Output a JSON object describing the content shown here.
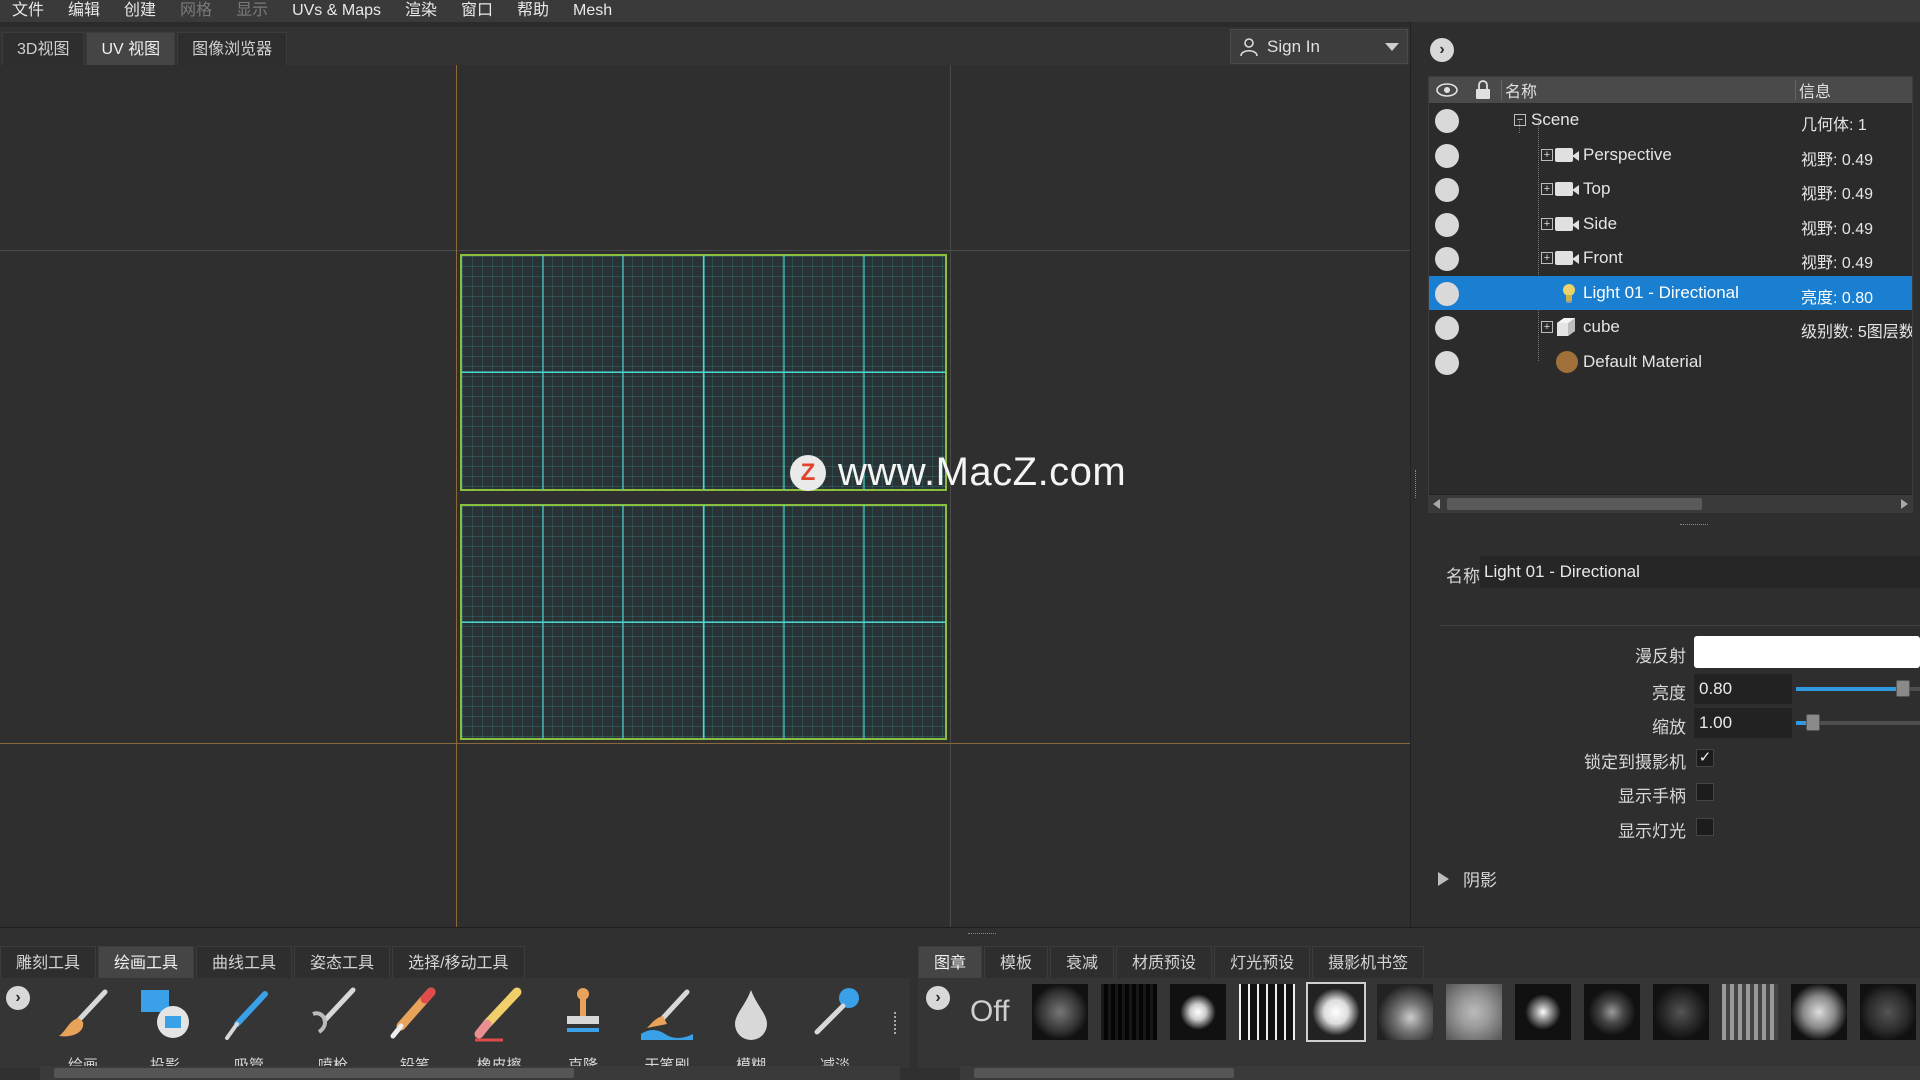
{
  "menu": {
    "file": "文件",
    "edit": "编辑",
    "create": "创建",
    "mesh_cn": "网格",
    "display": "显示",
    "uvs": "UVs & Maps",
    "render": "渲染",
    "window": "窗口",
    "help": "帮助",
    "mesh": "Mesh"
  },
  "view_tabs": [
    {
      "label": "3D视图"
    },
    {
      "label": "UV 视图"
    },
    {
      "label": "图像浏览器"
    }
  ],
  "signin": {
    "label": "Sign In"
  },
  "watermark": {
    "logo": "Z",
    "text": "www.MacZ.com"
  },
  "tree": {
    "header": {
      "name": "名称",
      "info": "信息"
    },
    "rows": [
      {
        "label": "Scene",
        "info": "几何体: 1"
      },
      {
        "label": "Perspective",
        "info": "视野: 0.49"
      },
      {
        "label": "Top",
        "info": "视野: 0.49"
      },
      {
        "label": "Side",
        "info": "视野: 0.49"
      },
      {
        "label": "Front",
        "info": "视野: 0.49"
      },
      {
        "label": "Light 01 - Directional",
        "info": "亮度: 0.80"
      },
      {
        "label": "cube",
        "info": "级别数: 5图层数"
      },
      {
        "label": "Default Material",
        "info": ""
      }
    ]
  },
  "properties": {
    "name_label": "名称",
    "name_value": "Light 01 - Directional",
    "diffuse_label": "漫反射",
    "diffuse_color": "#ffffff",
    "brightness_label": "亮度",
    "brightness_value": "0.80",
    "scale_label": "缩放",
    "scale_value": "1.00",
    "lock_camera_label": "锁定到摄影机",
    "lock_camera_checked": true,
    "lock_camera_mark": "✓",
    "show_handle_label": "显示手柄",
    "show_handle_checked": false,
    "show_light_label": "显示灯光",
    "show_light_checked": false,
    "shadow_label": "阴影"
  },
  "bottom_tabs_left": [
    {
      "label": "雕刻工具"
    },
    {
      "label": "绘画工具"
    },
    {
      "label": "曲线工具"
    },
    {
      "label": "姿态工具"
    },
    {
      "label": "选择/移动工具"
    }
  ],
  "bottom_tabs_right": [
    {
      "label": "图章"
    },
    {
      "label": "模板"
    },
    {
      "label": "衰减"
    },
    {
      "label": "材质预设"
    },
    {
      "label": "灯光预设"
    },
    {
      "label": "摄影机书签"
    }
  ],
  "paint_tools": [
    {
      "label": "绘画"
    },
    {
      "label": "投影"
    },
    {
      "label": "吸管"
    },
    {
      "label": "喷枪"
    },
    {
      "label": "铅笔"
    },
    {
      "label": "橡皮擦"
    },
    {
      "label": "克隆"
    },
    {
      "label": "干笔刷"
    },
    {
      "label": "模糊"
    },
    {
      "label": "减淡"
    }
  ],
  "stamps": {
    "off_label": "Off"
  },
  "colors": {
    "accent": "#1a7fd0",
    "uv_border": "#8abf3e",
    "uv_lines": "#48d6d0",
    "axis": "#8a6a3a"
  }
}
